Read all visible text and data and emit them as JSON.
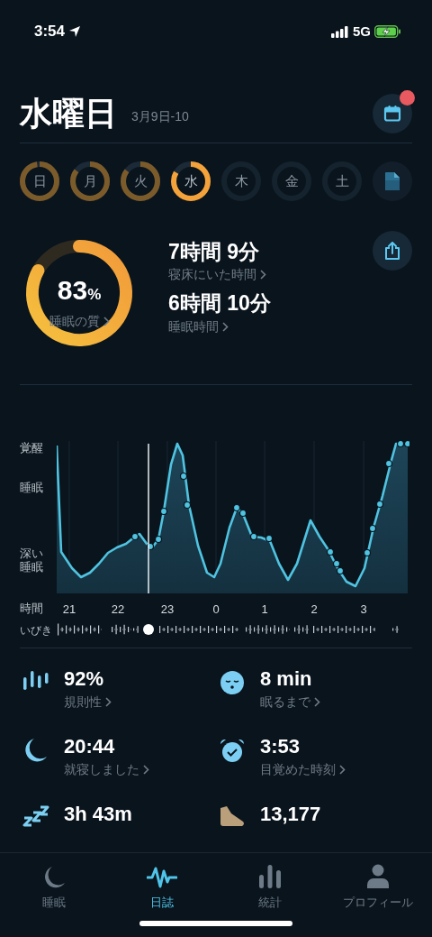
{
  "status_bar": {
    "time": "3:54",
    "network": "5G"
  },
  "header": {
    "title": "水曜日",
    "date_range": "3月9日-10",
    "notification": true
  },
  "days": [
    {
      "label": "日",
      "recorded": true,
      "selected": false
    },
    {
      "label": "月",
      "recorded": true,
      "selected": false
    },
    {
      "label": "火",
      "recorded": true,
      "selected": false
    },
    {
      "label": "水",
      "recorded": true,
      "selected": true
    },
    {
      "label": "木",
      "recorded": false,
      "selected": false
    },
    {
      "label": "金",
      "recorded": false,
      "selected": false
    },
    {
      "label": "土",
      "recorded": false,
      "selected": false
    }
  ],
  "summary": {
    "quality": {
      "value": "83",
      "unit": "%",
      "label": "睡眠の質"
    },
    "metrics": [
      {
        "value": "7時間 9分",
        "label": "寝床にいた時間"
      },
      {
        "value": "6時間 10分",
        "label": "睡眠時間"
      }
    ]
  },
  "chart": {
    "y_labels": [
      "覚醒",
      "睡眠",
      "深い睡眠"
    ],
    "time_label": "時間",
    "x_labels": [
      "21",
      "22",
      "23",
      "0",
      "1",
      "2",
      "3"
    ],
    "snore_label": "いびき"
  },
  "stats": [
    {
      "kind": "regularity",
      "value": "92%",
      "label": "規則性"
    },
    {
      "kind": "latency",
      "value": "8 min",
      "label": "眠るまで"
    },
    {
      "kind": "bedtime",
      "value": "20:44",
      "label": "就寝しました"
    },
    {
      "kind": "wakeup",
      "value": "3:53",
      "label": "目覚めた時刻"
    },
    {
      "kind": "snoring",
      "value": "3h 43m"
    },
    {
      "kind": "steps",
      "value": "13,177"
    }
  ],
  "tab_bar": [
    {
      "kind": "sleep",
      "label": "睡眠",
      "selected": false
    },
    {
      "kind": "journal",
      "label": "日誌",
      "selected": true
    },
    {
      "kind": "stats",
      "label": "統計",
      "selected": false
    },
    {
      "kind": "profile",
      "label": "プロフィール",
      "selected": false
    }
  ]
}
